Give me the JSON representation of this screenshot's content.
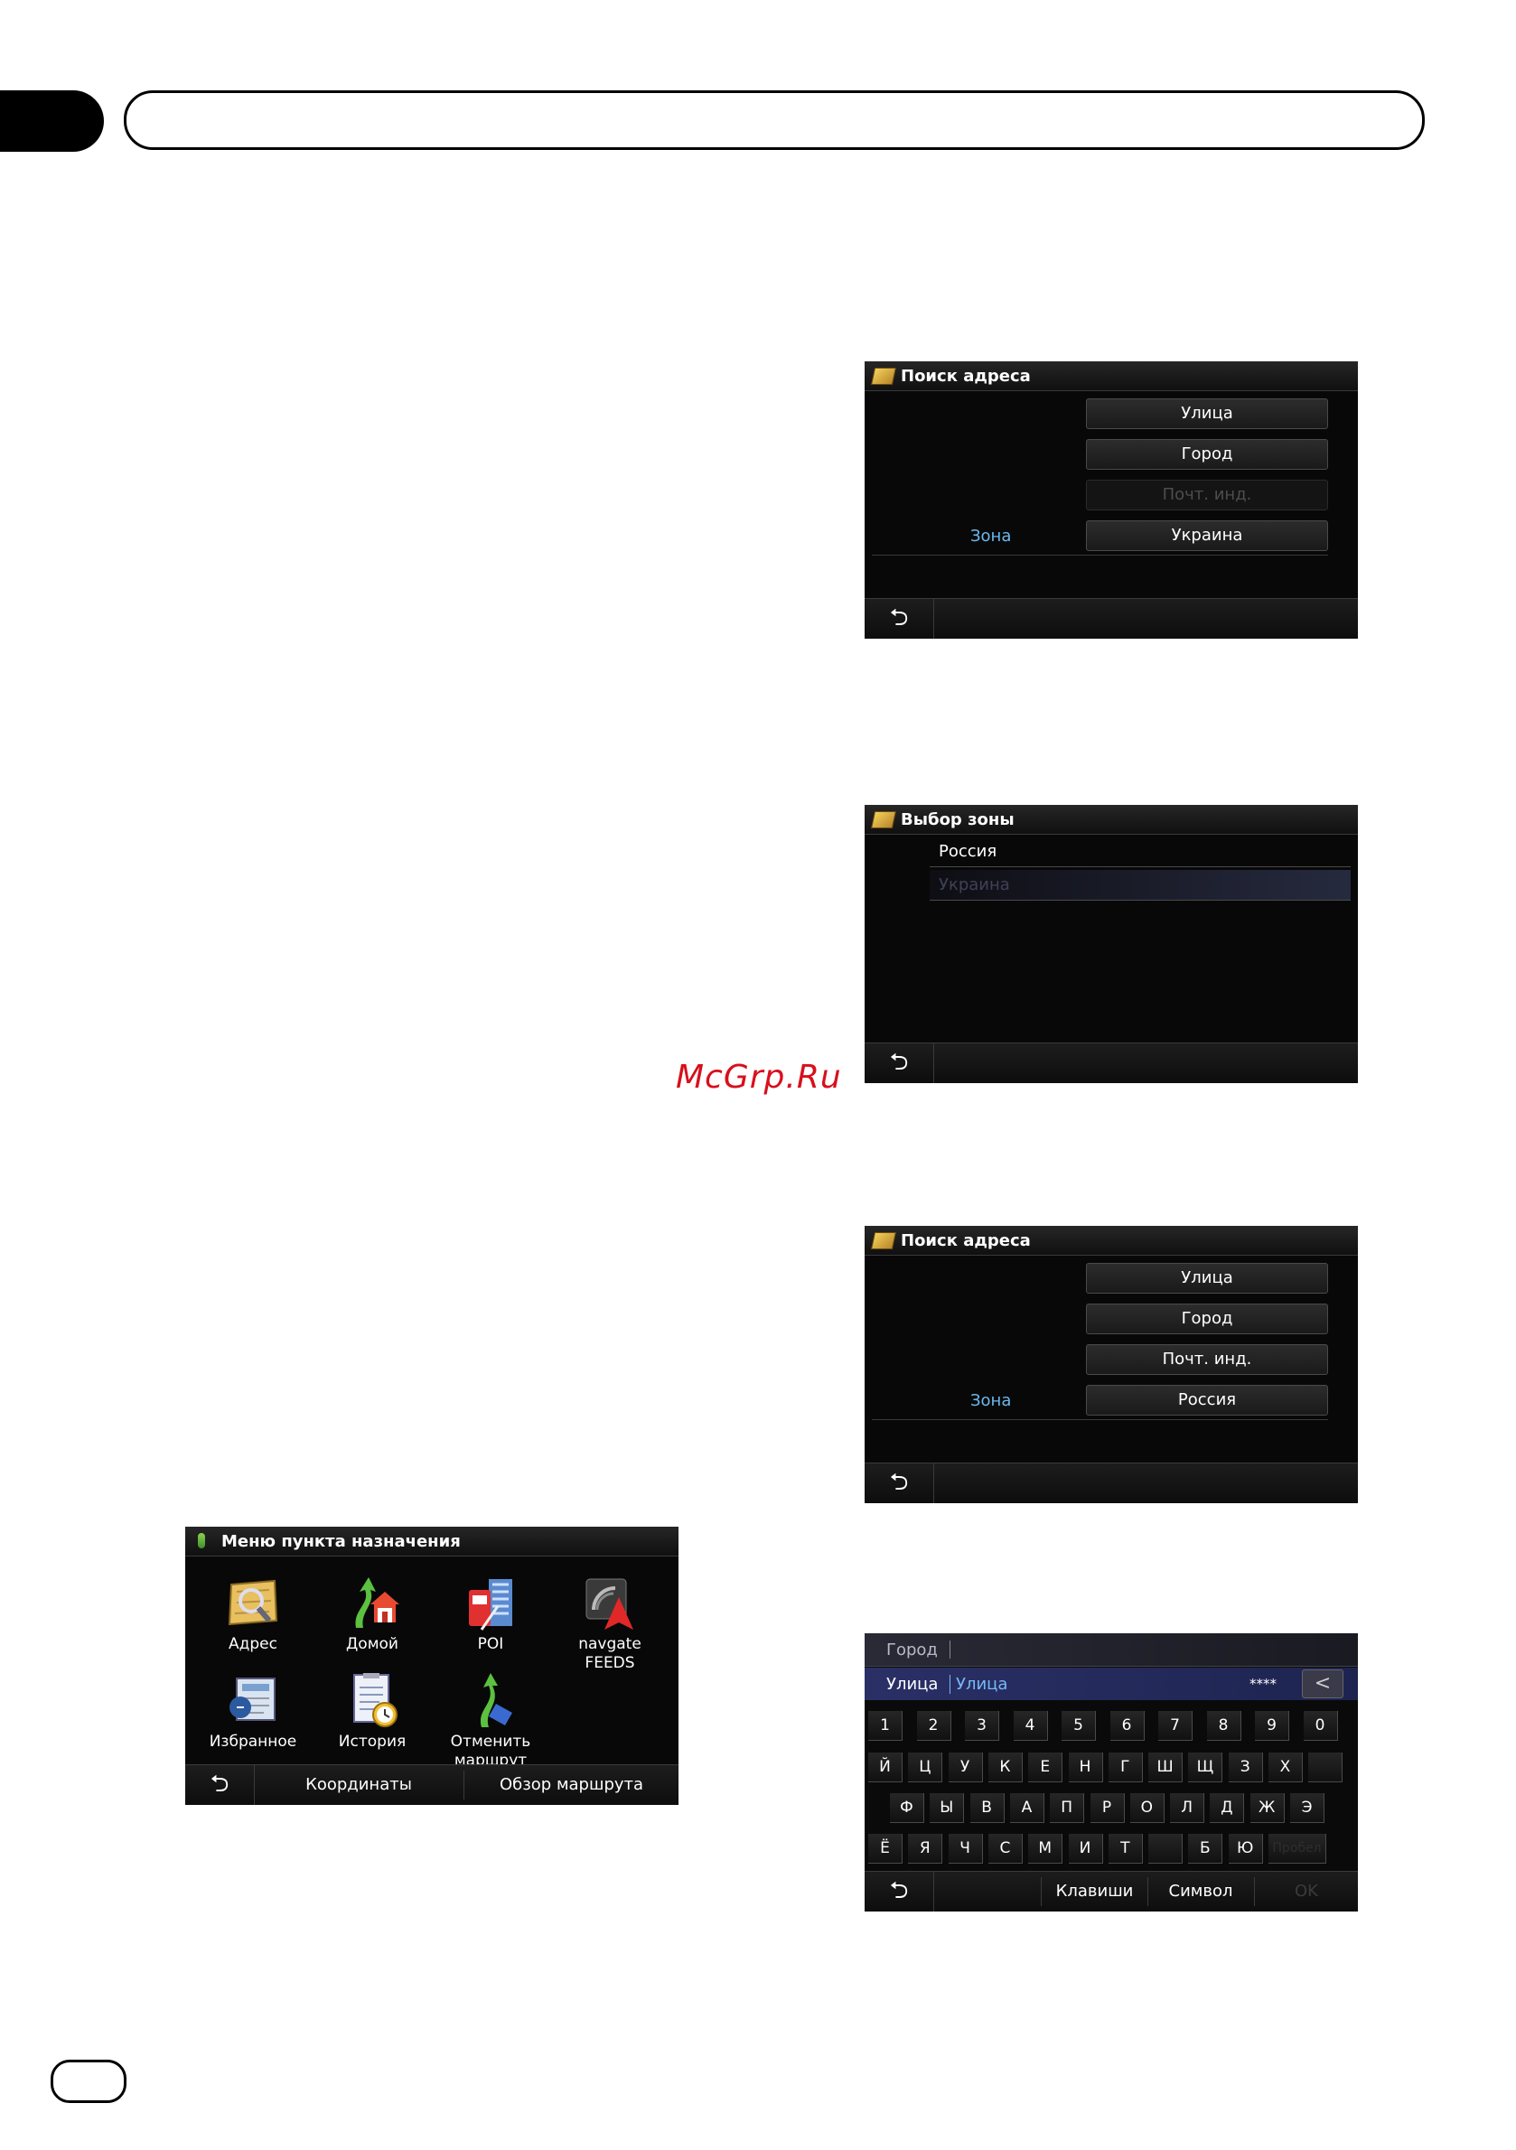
{
  "watermark": "McGrp.Ru",
  "screen1": {
    "title": "Поиск адреса",
    "buttons": [
      "Улица",
      "Город",
      "Почт. инд.",
      "Украина"
    ],
    "zone_label": "Зона",
    "back": "⮌"
  },
  "screen2": {
    "title": "Выбор зоны",
    "items": [
      "Россия",
      "Украина"
    ],
    "back": "⮌"
  },
  "screen3": {
    "title": "Поиск адреса",
    "buttons": [
      "Улица",
      "Город",
      "Почт. инд.",
      "Россия"
    ],
    "zone_label": "Зона",
    "back": "⮌"
  },
  "menu": {
    "title": "Меню пункта назначения",
    "items": [
      "Адрес",
      "Домой",
      "POI",
      "navgate FEEDS",
      "Избранное",
      "История",
      "Отменить маршрут"
    ],
    "bottom": [
      "Координаты",
      "Обзор маршрута"
    ],
    "back": "⮌"
  },
  "keyboard": {
    "field_city_label": "Город",
    "field_street_label": "Улица",
    "field_street_value": "Улица",
    "count": "****",
    "backspace": "<",
    "row1": [
      "1",
      "2",
      "3",
      "4",
      "5",
      "6",
      "7",
      "8",
      "9",
      "0"
    ],
    "row2": [
      "Й",
      "Ц",
      "У",
      "К",
      "Е",
      "Н",
      "Г",
      "Ш",
      "Щ",
      "З",
      "Х",
      ""
    ],
    "row3": [
      "Ф",
      "Ы",
      "В",
      "А",
      "П",
      "Р",
      "О",
      "Л",
      "Д",
      "Ж",
      "Э"
    ],
    "row4": [
      "Ё",
      "Я",
      "Ч",
      "С",
      "М",
      "И",
      "Т",
      "",
      "Б",
      "Ю",
      "Пробел"
    ],
    "bottom": [
      "Клавиши",
      "Символ",
      "OK"
    ],
    "back": "⮌"
  }
}
